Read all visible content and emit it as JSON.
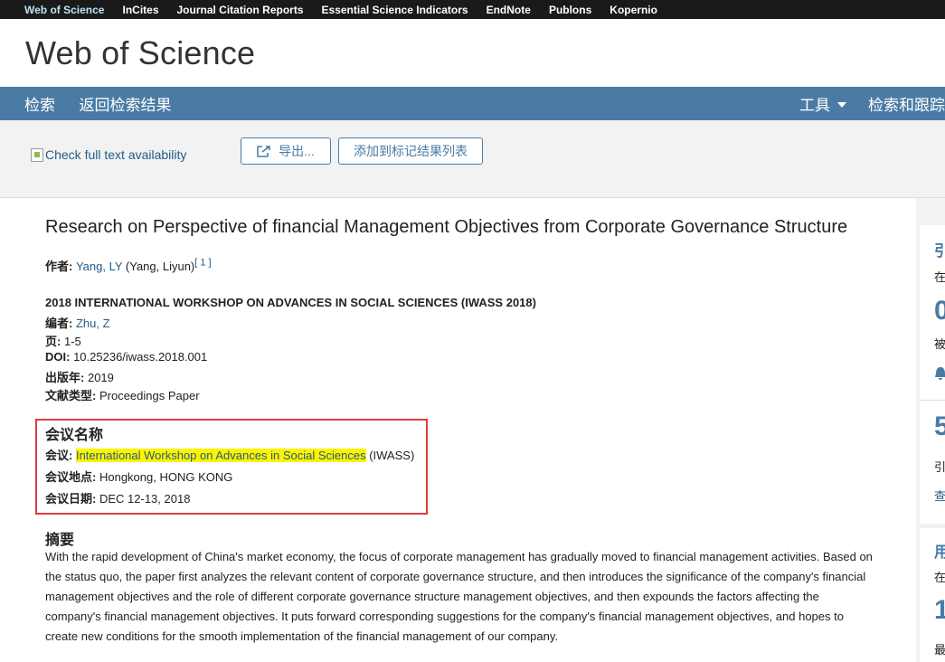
{
  "topnav": {
    "items": [
      "Web of Science",
      "InCites",
      "Journal Citation Reports",
      "Essential Science Indicators",
      "EndNote",
      "Publons",
      "Kopernio"
    ]
  },
  "brand": "Web of Science",
  "mainnav": {
    "search": "检索",
    "back": "返回检索结果",
    "tools": "工具",
    "search_track": "检索和跟踪"
  },
  "toolbar": {
    "fulltext": "Check full text availability",
    "export": "导出...",
    "add_marked": "添加到标记结果列表"
  },
  "record": {
    "title": "Research on Perspective of financial Management Objectives from Corporate Governance Structure",
    "author_label": "作者:",
    "author_link": "Yang, LY",
    "author_full": " (Yang, Liyun)",
    "author_ref": "[ 1 ]",
    "source": "2018 INTERNATIONAL WORKSHOP ON ADVANCES IN SOCIAL SCIENCES (IWASS 2018)",
    "editor_label": "编者:",
    "editor": "Zhu, Z",
    "pages_label": "页:",
    "pages": "1-5",
    "doi_label": "DOI:",
    "doi": "10.25236/iwass.2018.001",
    "year_label": "出版年:",
    "year": "2019",
    "doctype_label": "文献类型:",
    "doctype": "Proceedings Paper"
  },
  "conference": {
    "heading": "会议名称",
    "name_label": "会议:",
    "name": "International Workshop on Advances in Social Sciences",
    "abbr": " (IWASS)",
    "location_label": "会议地点:",
    "location": "Hongkong, HONG KONG",
    "date_label": "会议日期:",
    "date": "DEC 12-13, 2018"
  },
  "abstract": {
    "heading": "摘要",
    "text": "With the rapid development of China's market economy, the focus of corporate management has gradually moved to financial management activities. Based on the status quo, the paper first analyzes the relevant content of corporate governance structure, and then introduces the significance of the company's financial management objectives and the role of different corporate governance structure management objectives, and then expounds the factors affecting the company's financial management objectives. It puts forward corresponding suggestions for the company's financial management objectives, and hopes to create new conditions for the smooth implementation of the financial management of our company."
  },
  "sidebar": {
    "citation_head": "引",
    "citation_sub": "在",
    "citation_count": "0",
    "citation_label": "被",
    "refs_count": "5",
    "refs_label": "引",
    "refs_link": "查",
    "usage_head": "用",
    "usage_sub": "在",
    "usage_count": "1",
    "usage_label": "最"
  },
  "colors": {
    "topnav_bg": "#1a1a1a",
    "mainnav_bg": "#4a7ba5",
    "link": "#1f5c8a",
    "highlight": "#fff200",
    "box_border": "#e03a3a"
  }
}
